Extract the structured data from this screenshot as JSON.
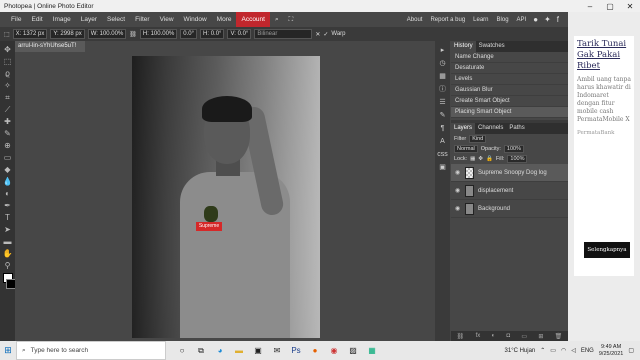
{
  "window": {
    "title": "Photopea | Online Photo Editor",
    "controls": [
      "–",
      "▢",
      "✕"
    ]
  },
  "menu": {
    "items": [
      "File",
      "Edit",
      "Image",
      "Layer",
      "Select",
      "Filter",
      "View",
      "Window",
      "More"
    ],
    "account": "Account",
    "links": [
      "About",
      "Report a bug",
      "Learn",
      "Blog",
      "API"
    ]
  },
  "options": {
    "x": "X: 1372 px",
    "y": "Y: 2998 px",
    "w": "W: 100.00%",
    "h": "H: 100.00%",
    "angle": "0.0°",
    "hskew": "H: 0.0°",
    "vskew": "V: 0.0°",
    "interp": "Bilinear",
    "warp": "Warp"
  },
  "document": {
    "tab": "arrul-lin-sYhUhse5uT!"
  },
  "history": {
    "tabs": [
      "History",
      "Swatches"
    ],
    "items": [
      "Name Change",
      "Desaturate",
      "Levels",
      "Gaussian Blur",
      "Create Smart Object",
      "Placing Smart Object"
    ]
  },
  "layers": {
    "tabs": [
      "Layers",
      "Channels",
      "Paths"
    ],
    "filter": "Filter",
    "kind": "Kind",
    "blend": "Normal",
    "opacity_label": "Opacity:",
    "opacity": "100%",
    "lock_label": "Lock:",
    "fill_label": "Fill:",
    "fill": "100%",
    "items": [
      "Supreme Snoopy Dog log",
      "displacement",
      "Background"
    ]
  },
  "ad": {
    "title": "Tarik Tunai Gak Pakai Ribet",
    "body": "Ambil uang tanpa harus khawatir di Indomaret dengan fitur mobile cash PermataMobile X",
    "source": "PermataBank",
    "button": "Selengkapnya"
  },
  "photo": {
    "logo_text": "Supreme"
  },
  "taskbar": {
    "search_placeholder": "Type here to search",
    "weather": "31°C  Hujan",
    "lang": "ENG",
    "time": "9:49 AM",
    "date": "9/25/2021"
  }
}
